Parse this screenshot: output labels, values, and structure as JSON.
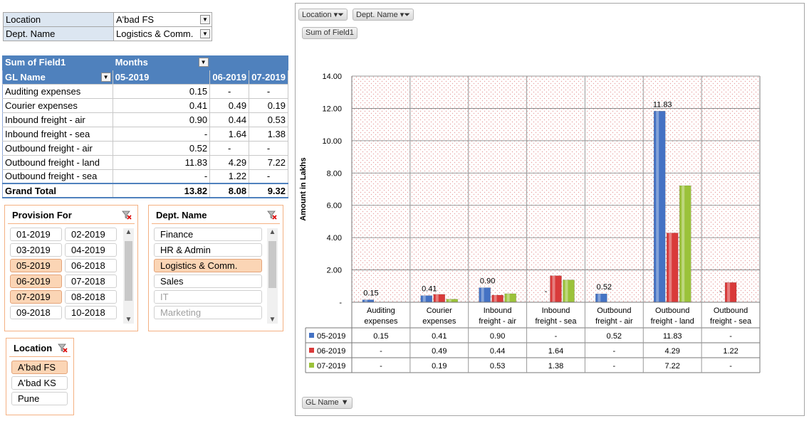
{
  "filters": [
    {
      "key": "Location",
      "value": "A'bad FS"
    },
    {
      "key": "Dept. Name",
      "value": "Logistics & Comm."
    }
  ],
  "pivot": {
    "header_value": "Sum of Field1",
    "header_cols": "Months",
    "row_field": "GL Name",
    "months": [
      "05-2019",
      "06-2019",
      "07-2019"
    ],
    "rows": [
      {
        "name": "Auditing expenses",
        "v": [
          "0.15",
          "-",
          "-"
        ]
      },
      {
        "name": "Courier expenses",
        "v": [
          "0.41",
          "0.49",
          "0.19"
        ]
      },
      {
        "name": "Inbound freight - air",
        "v": [
          "0.90",
          "0.44",
          "0.53"
        ]
      },
      {
        "name": "Inbound freight - sea",
        "v": [
          "-",
          "1.64",
          "1.38"
        ]
      },
      {
        "name": "Outbound freight - air",
        "v": [
          "0.52",
          "-",
          "-"
        ]
      },
      {
        "name": "Outbound freight - land",
        "v": [
          "11.83",
          "4.29",
          "7.22"
        ]
      },
      {
        "name": "Outbound freight - sea",
        "v": [
          "-",
          "1.22",
          "-"
        ]
      }
    ],
    "total_label": "Grand Total",
    "totals": [
      "13.82",
      "8.08",
      "9.32"
    ]
  },
  "slicers": {
    "provision": {
      "title": "Provision For",
      "items": [
        {
          "label": "01-2019",
          "sel": false
        },
        {
          "label": "02-2019",
          "sel": false
        },
        {
          "label": "03-2019",
          "sel": false
        },
        {
          "label": "04-2019",
          "sel": false
        },
        {
          "label": "05-2019",
          "sel": true
        },
        {
          "label": "06-2018",
          "sel": false
        },
        {
          "label": "06-2019",
          "sel": true
        },
        {
          "label": "07-2018",
          "sel": false
        },
        {
          "label": "07-2019",
          "sel": true
        },
        {
          "label": "08-2018",
          "sel": false
        },
        {
          "label": "09-2018",
          "sel": false
        },
        {
          "label": "10-2018",
          "sel": false
        }
      ]
    },
    "dept": {
      "title": "Dept. Name",
      "items": [
        {
          "label": "Finance",
          "sel": false,
          "dim": false
        },
        {
          "label": "HR & Admin",
          "sel": false,
          "dim": false
        },
        {
          "label": "Logistics & Comm.",
          "sel": true,
          "dim": false
        },
        {
          "label": "Sales",
          "sel": false,
          "dim": false
        },
        {
          "label": "IT",
          "sel": false,
          "dim": true
        },
        {
          "label": "Marketing",
          "sel": false,
          "dim": true
        }
      ]
    },
    "location": {
      "title": "Location",
      "items": [
        {
          "label": "A'bad FS",
          "sel": true
        },
        {
          "label": "A'bad KS",
          "sel": false
        },
        {
          "label": "Pune",
          "sel": false
        }
      ]
    }
  },
  "chart": {
    "filter_buttons": [
      "Location",
      "Dept. Name"
    ],
    "value_button": "Sum of Field1",
    "axis_button": "GL Name",
    "colors": {
      "05-2019": "#4472c4",
      "06-2019": "#d93a3a",
      "07-2019": "#9bc23a"
    }
  },
  "chart_data": {
    "type": "bar",
    "ylabel": "Amount in Lakhs",
    "ylim": [
      0,
      14
    ],
    "yticks": [
      "-",
      "2.00",
      "4.00",
      "6.00",
      "8.00",
      "10.00",
      "12.00",
      "14.00"
    ],
    "categories": [
      "Auditing expenses",
      "Courier expenses",
      "Inbound freight - air",
      "Inbound freight - sea",
      "Outbound freight - air",
      "Outbound freight - land",
      "Outbound freight - sea"
    ],
    "category_lines": [
      [
        "Auditing",
        "expenses"
      ],
      [
        "Courier",
        "expenses"
      ],
      [
        "Inbound",
        "freight - air"
      ],
      [
        "Inbound",
        "freight - sea"
      ],
      [
        "Outbound",
        "freight - air"
      ],
      [
        "Outbound",
        "freight - land"
      ],
      [
        "Outbound",
        "freight - sea"
      ]
    ],
    "series": [
      {
        "name": "05-2019",
        "values": [
          0.15,
          0.41,
          0.9,
          0,
          0.52,
          11.83,
          0
        ],
        "labels": [
          "0.15",
          "0.41",
          "0.90",
          "-",
          "0.52",
          "11.83",
          "-"
        ]
      },
      {
        "name": "06-2019",
        "values": [
          0,
          0.49,
          0.44,
          1.64,
          0,
          4.29,
          1.22
        ],
        "labels": [
          "-",
          "0.49",
          "0.44",
          "1.64",
          "-",
          "4.29",
          "1.22"
        ]
      },
      {
        "name": "07-2019",
        "values": [
          0,
          0.19,
          0.53,
          1.38,
          0,
          7.22,
          0
        ],
        "labels": [
          "-",
          "0.19",
          "0.53",
          "1.38",
          "-",
          "7.22",
          "-"
        ]
      }
    ],
    "bar_labels_shown": [
      "0.15",
      "0.41",
      "0.90",
      "-",
      "0.52",
      "11.83",
      "-"
    ],
    "grid": true,
    "data_table": true
  }
}
